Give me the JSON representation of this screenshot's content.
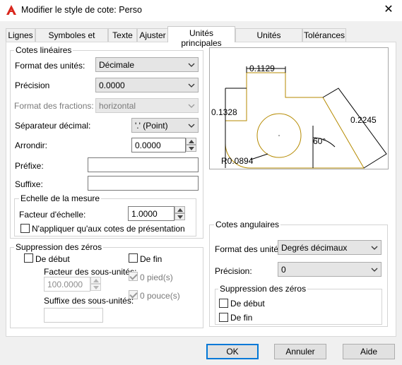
{
  "window": {
    "title": "Modifier le style de cote: Perso",
    "close": "✕"
  },
  "tabs": [
    "Lignes",
    "Symboles et flèches",
    "Texte",
    "Ajuster",
    "Unités principales",
    "Unités alternatives",
    "Tolérances"
  ],
  "linear": {
    "group": "Cotes linéaires",
    "format_label": "Format des unités:",
    "format_value": "Décimale",
    "precision_label": "Précision",
    "precision_value": "0.0000",
    "fraction_label": "Format des fractions:",
    "fraction_value": "horizontal",
    "separator_label": "Séparateur décimal:",
    "separator_value": "'.' (Point)",
    "round_label": "Arrondir:",
    "round_value": "0.0000",
    "prefix_label": "Préfixe:",
    "prefix_value": "",
    "suffix_label": "Suffixe:",
    "suffix_value": ""
  },
  "scale": {
    "group": "Echelle de la mesure",
    "factor_label": "Facteur d'échelle:",
    "factor_value": "1.0000",
    "layout_only_label": "N'appliquer qu'aux cotes de présentation"
  },
  "zero_linear": {
    "group": "Suppression des zéros",
    "leading": "De début",
    "trailing": "De fin",
    "sub_factor_label": "Facteur des sous-unités:",
    "sub_factor_value": "100.0000",
    "feet": "0 pied(s)",
    "inches": "0 pouce(s)",
    "sub_suffix_label": "Suffixe des sous-unités:",
    "sub_suffix_value": ""
  },
  "preview": {
    "dim_top": "0.1129",
    "dim_left": "0.1328",
    "dim_right": "0.2245",
    "angle": "60°",
    "radius": "R0.0894"
  },
  "angular": {
    "group": "Cotes angulaires",
    "format_label": "Format des unités:",
    "format_value": "Degrés décimaux",
    "precision_label": "Précision:",
    "precision_value": "0",
    "zero_group": "Suppression des zéros",
    "leading": "De début",
    "trailing": "De fin"
  },
  "buttons": {
    "ok": "OK",
    "cancel": "Annuler",
    "help": "Aide"
  },
  "colors": {
    "accent": "#0078d7",
    "geometry": "#b58a00",
    "app_icon": "#d9261c"
  }
}
